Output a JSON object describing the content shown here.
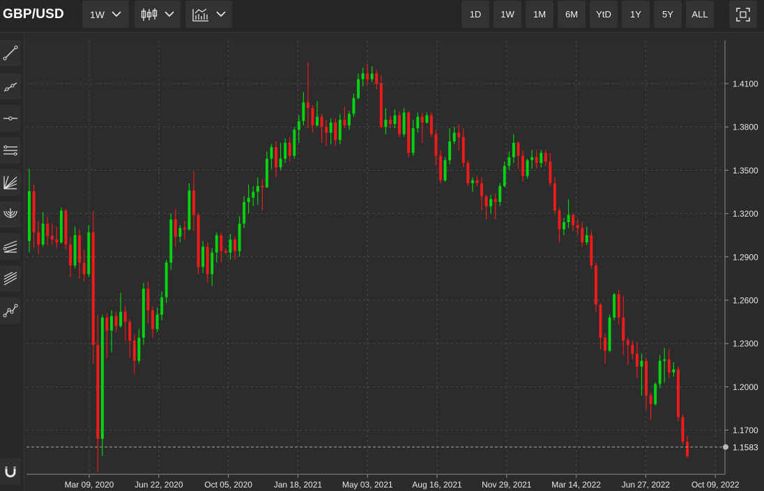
{
  "header": {
    "symbol": "GBP/USD",
    "interval_label": "1W",
    "chart_style_icon": "candlestick-icon",
    "indicators_icon": "indicators-icon",
    "ranges": [
      "1D",
      "1W",
      "1M",
      "6M",
      "YtD",
      "1Y",
      "5Y",
      "ALL"
    ],
    "fullscreen_icon": "fullscreen-icon"
  },
  "sidebar": {
    "tools": [
      "trend-line-icon",
      "ray-line-icon",
      "horizontal-line-icon",
      "parallel-channel-icon",
      "fan-lines-icon",
      "fibonacci-arc-icon",
      "pitchfork-icon",
      "fibonacci-channel-icon",
      "path-icon"
    ],
    "bottom_tool": "magnet-icon"
  },
  "colors": {
    "up": "#00d40e",
    "down": "#f21a1a",
    "background": "#2a2b2a",
    "grid": "#4a4b4a"
  },
  "chart_data": {
    "type": "candlestick",
    "interval": "weekly",
    "y_ticks": [
      "1.1700",
      "1.2000",
      "1.2300",
      "1.2600",
      "1.2900",
      "1.3200",
      "1.3500",
      "1.3800",
      "1.4100"
    ],
    "x_ticks": [
      "Mar 09, 2020",
      "Jun 22, 2020",
      "Oct 05, 2020",
      "Jan 18, 2021",
      "May 03, 2021",
      "Aug 16, 2021",
      "Nov 29, 2021",
      "Mar 14, 2022",
      "Jun 27, 2022",
      "Oct 09, 2022"
    ],
    "ylim": [
      1.12,
      1.45
    ],
    "grid": true,
    "last_price": "1.1583",
    "candles": [
      [
        1.301,
        1.3355,
        1.293,
        1.351
      ],
      [
        1.3355,
        1.307,
        1.296,
        1.34
      ],
      [
        1.307,
        1.2985,
        1.292,
        1.315
      ],
      [
        1.2985,
        1.313,
        1.297,
        1.321
      ],
      [
        1.313,
        1.3045,
        1.298,
        1.318
      ],
      [
        1.3045,
        1.302,
        1.298,
        1.313
      ],
      [
        1.302,
        1.3,
        1.296,
        1.311
      ],
      [
        1.3,
        1.322,
        1.299,
        1.324
      ],
      [
        1.322,
        1.2985,
        1.295,
        1.323
      ],
      [
        1.2985,
        1.284,
        1.276,
        1.304
      ],
      [
        1.284,
        1.305,
        1.282,
        1.311
      ],
      [
        1.305,
        1.286,
        1.275,
        1.309
      ],
      [
        1.286,
        1.278,
        1.273,
        1.295
      ],
      [
        1.278,
        1.307,
        1.276,
        1.312
      ],
      [
        1.307,
        1.229,
        1.216,
        1.322
      ],
      [
        1.229,
        1.164,
        1.141,
        1.25
      ],
      [
        1.164,
        1.248,
        1.152,
        1.25
      ],
      [
        1.248,
        1.239,
        1.22,
        1.251
      ],
      [
        1.239,
        1.249,
        1.224,
        1.253
      ],
      [
        1.249,
        1.242,
        1.238,
        1.252
      ],
      [
        1.242,
        1.252,
        1.241,
        1.265
      ],
      [
        1.252,
        1.245,
        1.232,
        1.256
      ],
      [
        1.245,
        1.232,
        1.22,
        1.247
      ],
      [
        1.232,
        1.218,
        1.209,
        1.236
      ],
      [
        1.218,
        1.234,
        1.216,
        1.24
      ],
      [
        1.234,
        1.268,
        1.229,
        1.272
      ],
      [
        1.268,
        1.253,
        1.244,
        1.273
      ],
      [
        1.253,
        1.24,
        1.234,
        1.256
      ],
      [
        1.24,
        1.25,
        1.238,
        1.255
      ],
      [
        1.25,
        1.262,
        1.246,
        1.266
      ],
      [
        1.262,
        1.286,
        1.258,
        1.288
      ],
      [
        1.286,
        1.316,
        1.281,
        1.32
      ],
      [
        1.316,
        1.304,
        1.297,
        1.323
      ],
      [
        1.304,
        1.31,
        1.3,
        1.312
      ],
      [
        1.31,
        1.309,
        1.302,
        1.315
      ],
      [
        1.309,
        1.336,
        1.308,
        1.341
      ],
      [
        1.336,
        1.319,
        1.308,
        1.349
      ],
      [
        1.319,
        1.283,
        1.278,
        1.32
      ],
      [
        1.283,
        1.297,
        1.279,
        1.301
      ],
      [
        1.297,
        1.278,
        1.272,
        1.3
      ],
      [
        1.278,
        1.293,
        1.27,
        1.296
      ],
      [
        1.293,
        1.305,
        1.286,
        1.307
      ],
      [
        1.305,
        1.294,
        1.286,
        1.307
      ],
      [
        1.294,
        1.293,
        1.292,
        1.296
      ],
      [
        1.293,
        1.302,
        1.288,
        1.306
      ],
      [
        1.302,
        1.294,
        1.288,
        1.304
      ],
      [
        1.294,
        1.313,
        1.29,
        1.318
      ],
      [
        1.313,
        1.328,
        1.31,
        1.332
      ],
      [
        1.328,
        1.331,
        1.32,
        1.34
      ],
      [
        1.331,
        1.335,
        1.325,
        1.339
      ],
      [
        1.335,
        1.339,
        1.326,
        1.345
      ],
      [
        1.339,
        1.338,
        1.322,
        1.344
      ],
      [
        1.338,
        1.358,
        1.338,
        1.363
      ],
      [
        1.358,
        1.366,
        1.351,
        1.368
      ],
      [
        1.366,
        1.352,
        1.345,
        1.37
      ],
      [
        1.352,
        1.358,
        1.35,
        1.369
      ],
      [
        1.358,
        1.369,
        1.355,
        1.372
      ],
      [
        1.369,
        1.36,
        1.356,
        1.373
      ],
      [
        1.36,
        1.378,
        1.358,
        1.38
      ],
      [
        1.378,
        1.384,
        1.369,
        1.388
      ],
      [
        1.384,
        1.397,
        1.381,
        1.404
      ],
      [
        1.397,
        1.393,
        1.379,
        1.425
      ],
      [
        1.393,
        1.381,
        1.376,
        1.395
      ],
      [
        1.381,
        1.387,
        1.38,
        1.398
      ],
      [
        1.387,
        1.38,
        1.369,
        1.389
      ],
      [
        1.38,
        1.376,
        1.367,
        1.385
      ],
      [
        1.376,
        1.383,
        1.368,
        1.386
      ],
      [
        1.383,
        1.371,
        1.367,
        1.386
      ],
      [
        1.371,
        1.385,
        1.368,
        1.389
      ],
      [
        1.385,
        1.381,
        1.379,
        1.394
      ],
      [
        1.381,
        1.389,
        1.378,
        1.391
      ],
      [
        1.389,
        1.4,
        1.387,
        1.403
      ],
      [
        1.4,
        1.413,
        1.399,
        1.417
      ],
      [
        1.413,
        1.417,
        1.408,
        1.421
      ],
      [
        1.417,
        1.413,
        1.409,
        1.424
      ],
      [
        1.413,
        1.417,
        1.411,
        1.422
      ],
      [
        1.417,
        1.41,
        1.406,
        1.42
      ],
      [
        1.41,
        1.38,
        1.379,
        1.416
      ],
      [
        1.38,
        1.385,
        1.375,
        1.393
      ],
      [
        1.385,
        1.382,
        1.379,
        1.388
      ],
      [
        1.382,
        1.388,
        1.379,
        1.392
      ],
      [
        1.388,
        1.375,
        1.373,
        1.391
      ],
      [
        1.375,
        1.39,
        1.373,
        1.393
      ],
      [
        1.39,
        1.362,
        1.359,
        1.391
      ],
      [
        1.362,
        1.379,
        1.36,
        1.385
      ],
      [
        1.379,
        1.387,
        1.376,
        1.39
      ],
      [
        1.387,
        1.383,
        1.369,
        1.39
      ],
      [
        1.383,
        1.388,
        1.382,
        1.39
      ],
      [
        1.388,
        1.375,
        1.373,
        1.39
      ],
      [
        1.375,
        1.36,
        1.353,
        1.378
      ],
      [
        1.36,
        1.343,
        1.341,
        1.364
      ],
      [
        1.343,
        1.357,
        1.342,
        1.359
      ],
      [
        1.357,
        1.37,
        1.354,
        1.379
      ],
      [
        1.37,
        1.376,
        1.368,
        1.38
      ],
      [
        1.376,
        1.373,
        1.364,
        1.382
      ],
      [
        1.373,
        1.355,
        1.352,
        1.379
      ],
      [
        1.355,
        1.341,
        1.339,
        1.357
      ],
      [
        1.341,
        1.343,
        1.335,
        1.345
      ],
      [
        1.343,
        1.341,
        1.339,
        1.346
      ],
      [
        1.341,
        1.332,
        1.322,
        1.345
      ],
      [
        1.332,
        1.325,
        1.316,
        1.333
      ],
      [
        1.325,
        1.33,
        1.32,
        1.333
      ],
      [
        1.33,
        1.328,
        1.316,
        1.334
      ],
      [
        1.328,
        1.339,
        1.325,
        1.341
      ],
      [
        1.339,
        1.353,
        1.338,
        1.356
      ],
      [
        1.353,
        1.359,
        1.35,
        1.363
      ],
      [
        1.359,
        1.369,
        1.355,
        1.375
      ],
      [
        1.369,
        1.36,
        1.351,
        1.37
      ],
      [
        1.36,
        1.346,
        1.342,
        1.364
      ],
      [
        1.346,
        1.357,
        1.344,
        1.358
      ],
      [
        1.357,
        1.359,
        1.351,
        1.364
      ],
      [
        1.359,
        1.355,
        1.351,
        1.364
      ],
      [
        1.355,
        1.362,
        1.352,
        1.364
      ],
      [
        1.362,
        1.356,
        1.353,
        1.364
      ],
      [
        1.356,
        1.341,
        1.339,
        1.362
      ],
      [
        1.341,
        1.322,
        1.32,
        1.345
      ],
      [
        1.322,
        1.309,
        1.3,
        1.324
      ],
      [
        1.309,
        1.314,
        1.305,
        1.317
      ],
      [
        1.314,
        1.319,
        1.31,
        1.33
      ],
      [
        1.319,
        1.312,
        1.308,
        1.32
      ],
      [
        1.312,
        1.31,
        1.305,
        1.316
      ],
      [
        1.31,
        1.3,
        1.297,
        1.314
      ],
      [
        1.3,
        1.305,
        1.298,
        1.311
      ],
      [
        1.305,
        1.284,
        1.282,
        1.308
      ],
      [
        1.284,
        1.257,
        1.252,
        1.286
      ],
      [
        1.257,
        1.234,
        1.226,
        1.258
      ],
      [
        1.234,
        1.225,
        1.216,
        1.237
      ],
      [
        1.225,
        1.248,
        1.224,
        1.25
      ],
      [
        1.248,
        1.264,
        1.246,
        1.265
      ],
      [
        1.264,
        1.248,
        1.243,
        1.267
      ],
      [
        1.248,
        1.232,
        1.222,
        1.263
      ],
      [
        1.232,
        1.229,
        1.215,
        1.234
      ],
      [
        1.229,
        1.223,
        1.219,
        1.232
      ],
      [
        1.223,
        1.214,
        1.206,
        1.231
      ],
      [
        1.214,
        1.218,
        1.194,
        1.223
      ],
      [
        1.218,
        1.194,
        1.184,
        1.22
      ],
      [
        1.194,
        1.188,
        1.177,
        1.196
      ],
      [
        1.188,
        1.202,
        1.187,
        1.203
      ],
      [
        1.202,
        1.218,
        1.199,
        1.222
      ],
      [
        1.218,
        1.219,
        1.203,
        1.227
      ],
      [
        1.219,
        1.21,
        1.206,
        1.226
      ],
      [
        1.21,
        1.212,
        1.207,
        1.217
      ],
      [
        1.212,
        1.179,
        1.176,
        1.214
      ],
      [
        1.179,
        1.162,
        1.16,
        1.181
      ],
      [
        1.162,
        1.152,
        1.151,
        1.166
      ]
    ]
  }
}
